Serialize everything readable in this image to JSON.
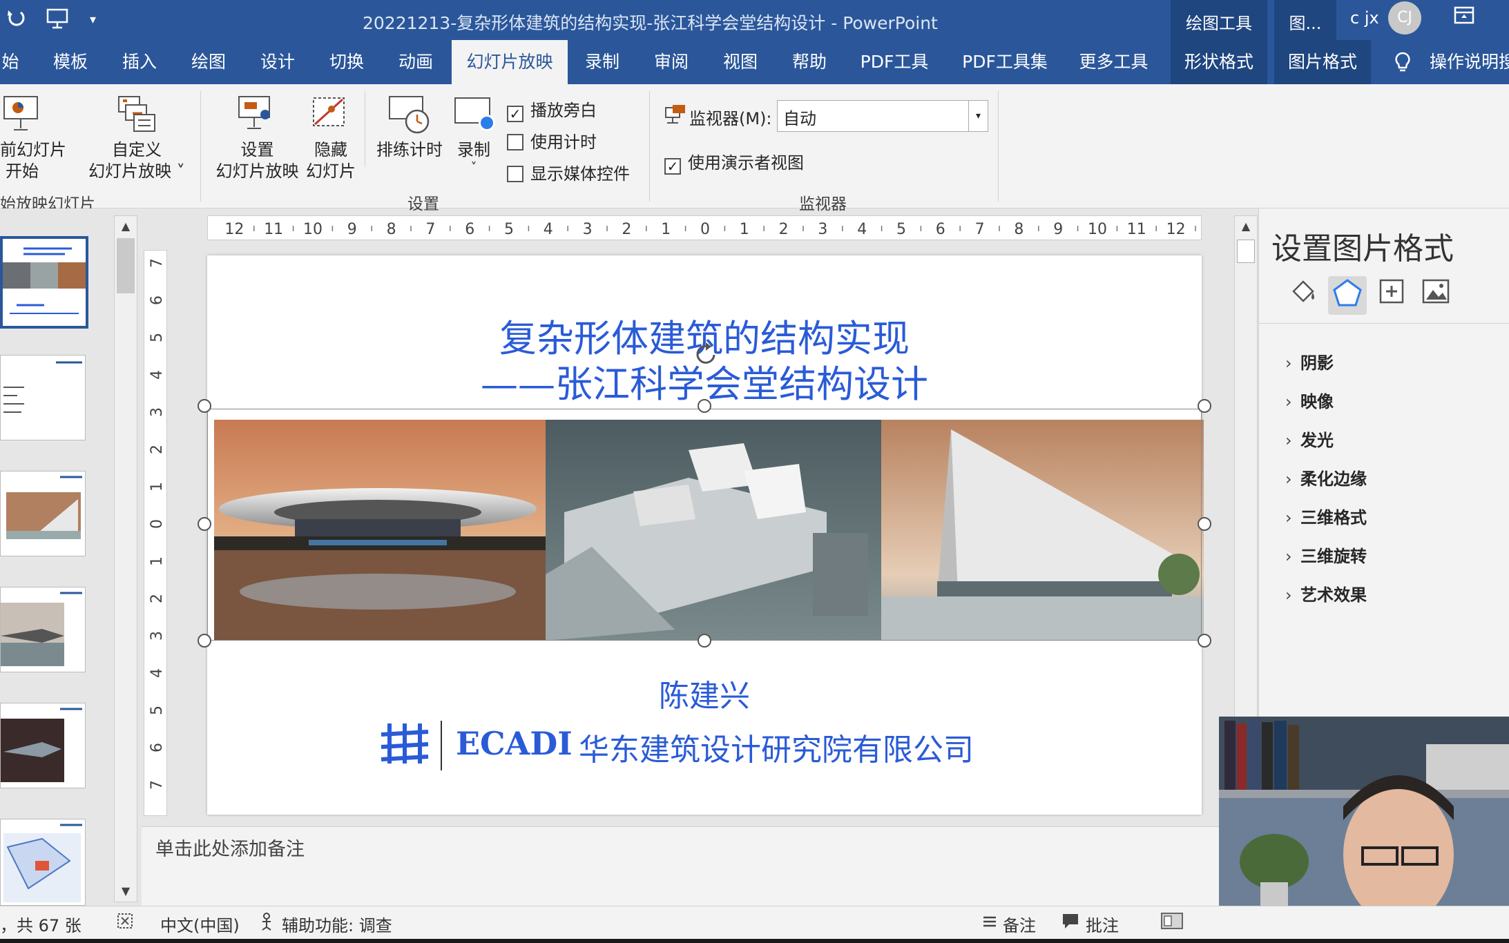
{
  "window": {
    "title": "20221213-复杂形体建筑的结构实现-张江科学会堂结构设计  -  PowerPoint",
    "context_tab_drawing": "绘图工具",
    "context_tab_picture": "图...",
    "user_name": "c jx",
    "user_initials": "CJ"
  },
  "tabs": [
    {
      "label": "始"
    },
    {
      "label": "模板"
    },
    {
      "label": "插入"
    },
    {
      "label": "绘图"
    },
    {
      "label": "设计"
    },
    {
      "label": "切换"
    },
    {
      "label": "动画"
    },
    {
      "label": "幻灯片放映"
    },
    {
      "label": "录制"
    },
    {
      "label": "审阅"
    },
    {
      "label": "视图"
    },
    {
      "label": "帮助"
    },
    {
      "label": "PDF工具"
    },
    {
      "label": "PDF工具集"
    },
    {
      "label": "更多工具"
    },
    {
      "label": "形状格式"
    },
    {
      "label": "图片格式"
    },
    {
      "label": "操作说明搜"
    }
  ],
  "ribbon": {
    "from_current_l1": "前幻灯片",
    "from_current_l2": "开始",
    "custom_show_l1": "自定义",
    "custom_show_l2": "幻灯片放映 ˅",
    "group_start": "始放映幻灯片",
    "setup_show_l1": "设置",
    "setup_show_l2": "幻灯片放映",
    "hide_slide_l1": "隐藏",
    "hide_slide_l2": "幻灯片",
    "rehearse": "排练计时",
    "record": "录制",
    "record_arrow": "˅",
    "chk_narration": "播放旁白",
    "chk_timings": "使用计时",
    "chk_media": "显示媒体控件",
    "group_setup": "设置",
    "monitor_label": "监视器(M):",
    "monitor_value": "自动",
    "chk_presenter": "使用演示者视图",
    "group_monitor": "监视器",
    "check_mark": "✓",
    "dropdown_arrow": "▾"
  },
  "ruler": {
    "horizontal": [
      "12",
      "11",
      "10",
      "9",
      "8",
      "7",
      "6",
      "5",
      "4",
      "3",
      "2",
      "1",
      "0",
      "1",
      "2",
      "3",
      "4",
      "5",
      "6",
      "7",
      "8",
      "9",
      "10",
      "11",
      "12"
    ],
    "vertical": [
      "7",
      "6",
      "5",
      "4",
      "3",
      "2",
      "1",
      "0",
      "1",
      "2",
      "3",
      "4",
      "5",
      "6",
      "7"
    ]
  },
  "slide": {
    "title_line1": "复杂形体建筑的结构实现",
    "title_line2": "——张江科学会堂结构设计",
    "author": "陈建兴",
    "logo_word": "ECADI",
    "company": "华东建筑设计研究院有限公司"
  },
  "notes_placeholder": "单击此处添加备注",
  "format_pane": {
    "title": "设置图片格式",
    "items": [
      {
        "label": "阴影"
      },
      {
        "label": "映像"
      },
      {
        "label": "发光"
      },
      {
        "label": "柔化边缘"
      },
      {
        "label": "三维格式"
      },
      {
        "label": "三维旋转"
      },
      {
        "label": "艺术效果"
      }
    ],
    "chevron": "›"
  },
  "status": {
    "slide_count": "，共 67 张",
    "language": "中文(中国)",
    "accessibility": "辅助功能: 调查",
    "notes": "备注",
    "comments": "批注"
  },
  "colors": {
    "ribbon_blue": "#2b579a",
    "slide_blue": "#2a5bd7"
  }
}
